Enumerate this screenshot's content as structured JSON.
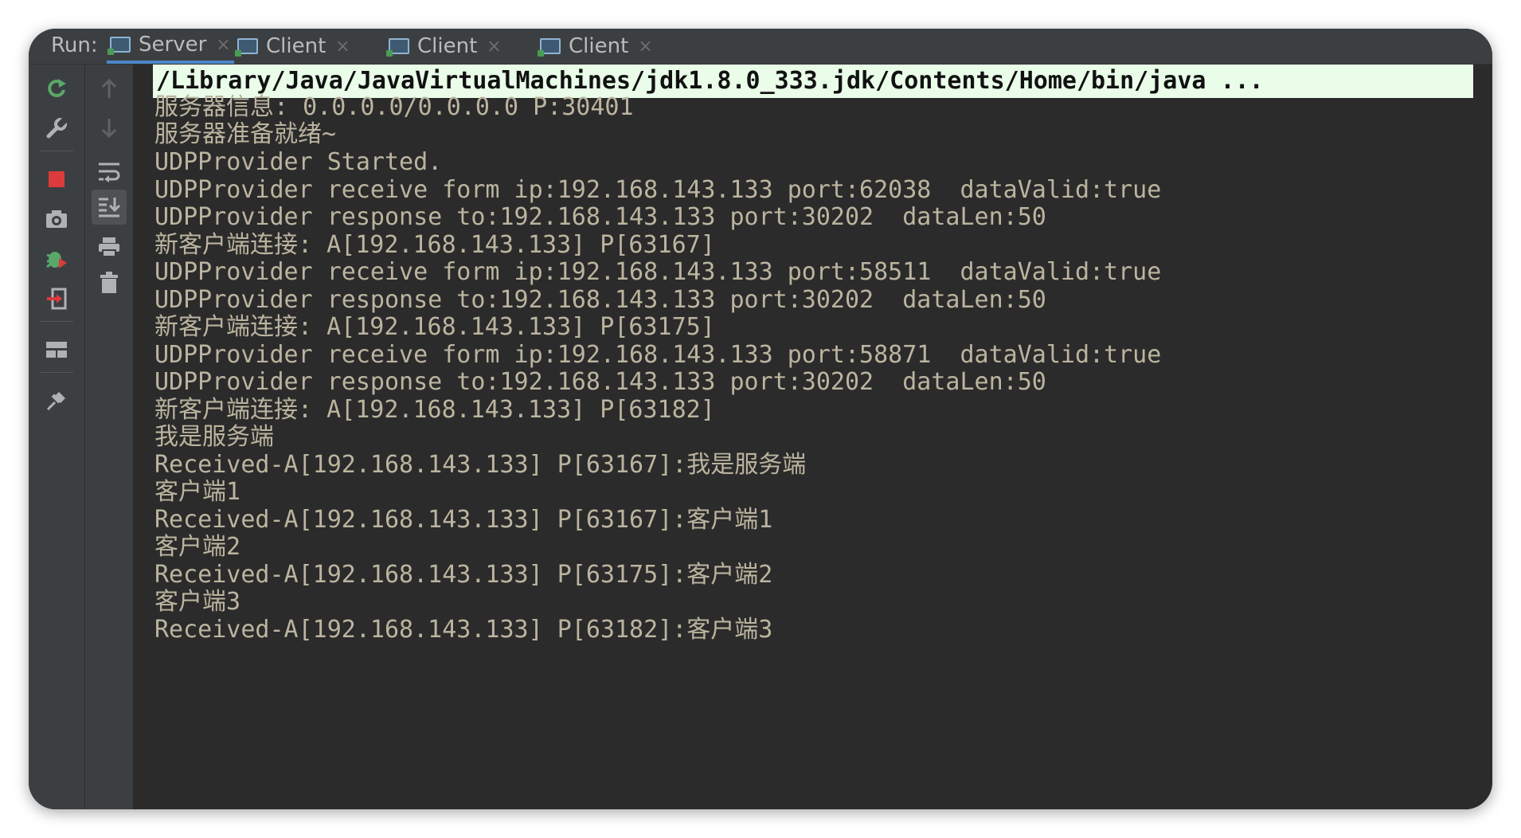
{
  "run_panel": {
    "label": "Run:",
    "tabs": [
      {
        "label": "Server",
        "active": true
      },
      {
        "label": "Client",
        "active": false
      },
      {
        "label": "Client",
        "active": false
      },
      {
        "label": "Client",
        "active": false
      }
    ]
  },
  "toolbar": {
    "left_icons": [
      "rerun-icon",
      "settings-icon",
      "stop-icon",
      "screenshot-icon",
      "debug-icon",
      "exit-icon",
      "layout-icon",
      "pin-icon"
    ],
    "right_icons": [
      "up-arrow-icon",
      "down-arrow-icon",
      "soft-wrap-icon",
      "scroll-to-end-icon",
      "print-icon",
      "trash-icon"
    ]
  },
  "console": {
    "command_line": "/Library/Java/JavaVirtualMachines/jdk1.8.0_333.jdk/Contents/Home/bin/java ...",
    "lines": [
      "服务器信息: 0.0.0.0/0.0.0.0 P:30401",
      "服务器准备就绪~",
      "UDPProvider Started.",
      "UDPProvider receive form ip:192.168.143.133 port:62038  dataValid:true",
      "UDPProvider response to:192.168.143.133 port:30202  dataLen:50",
      "新客户端连接: A[192.168.143.133] P[63167]",
      "UDPProvider receive form ip:192.168.143.133 port:58511  dataValid:true",
      "UDPProvider response to:192.168.143.133 port:30202  dataLen:50",
      "新客户端连接: A[192.168.143.133] P[63175]",
      "UDPProvider receive form ip:192.168.143.133 port:58871  dataValid:true",
      "UDPProvider response to:192.168.143.133 port:30202  dataLen:50",
      "新客户端连接: A[192.168.143.133] P[63182]",
      "我是服务端",
      "Received-A[192.168.143.133] P[63167]:我是服务端",
      "客户端1",
      "Received-A[192.168.143.133] P[63167]:客户端1",
      "客户端2",
      "Received-A[192.168.143.133] P[63175]:客户端2",
      "客户端3",
      "Received-A[192.168.143.133] P[63182]:客户端3"
    ]
  },
  "colors": {
    "console_bg": "#2b2b2b",
    "console_text": "#bbb49f",
    "command_highlight": "#e9fde9",
    "panel_bg": "#3c3f41",
    "active_tab_underline": "#4a88c7"
  }
}
